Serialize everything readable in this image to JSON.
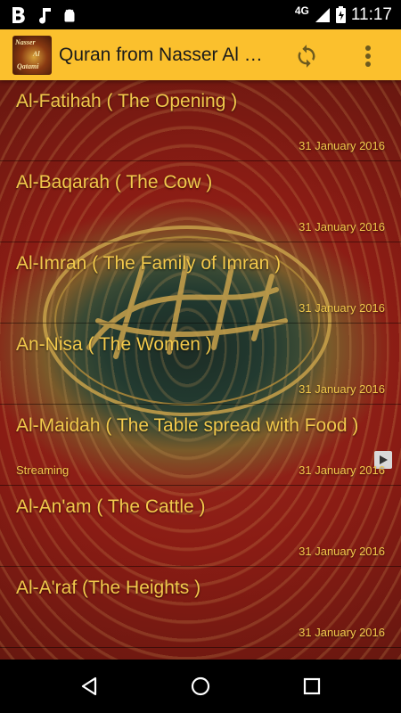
{
  "status_bar": {
    "network": "4G",
    "time": "11:17",
    "icons": [
      "b-app-icon",
      "music-note-icon",
      "android-icon",
      "signal-icon",
      "battery-icon"
    ]
  },
  "app_bar": {
    "logo_text": [
      "Nasser",
      "Al",
      "Qatami"
    ],
    "title": "Quran from Nasser Al Qatami",
    "color": "#fbc02d",
    "actions": [
      "refresh-icon",
      "more-vert-icon"
    ]
  },
  "items": [
    {
      "title": "Al-Fatihah ( The Opening )",
      "date": "31 January 2016",
      "status": ""
    },
    {
      "title": "Al-Baqarah ( The Cow )",
      "date": "31 January 2016",
      "status": ""
    },
    {
      "title": "Al-Imran ( The Family of Imran )",
      "date": "31 January 2016",
      "status": ""
    },
    {
      "title": "An-Nisa ( The Women )",
      "date": "31 January 2016",
      "status": ""
    },
    {
      "title": "Al-Maidah ( The Table spread with Food )",
      "date": "31 January 2016",
      "status": "Streaming"
    },
    {
      "title": "Al-An'am ( The Cattle )",
      "date": "31 January 2016",
      "status": ""
    },
    {
      "title": "Al-A'raf (The Heights )",
      "date": "31 January 2016",
      "status": ""
    }
  ],
  "text_color": "#f2c94c",
  "nav_bar": {
    "buttons": [
      "back-icon",
      "home-icon",
      "recents-icon"
    ]
  }
}
